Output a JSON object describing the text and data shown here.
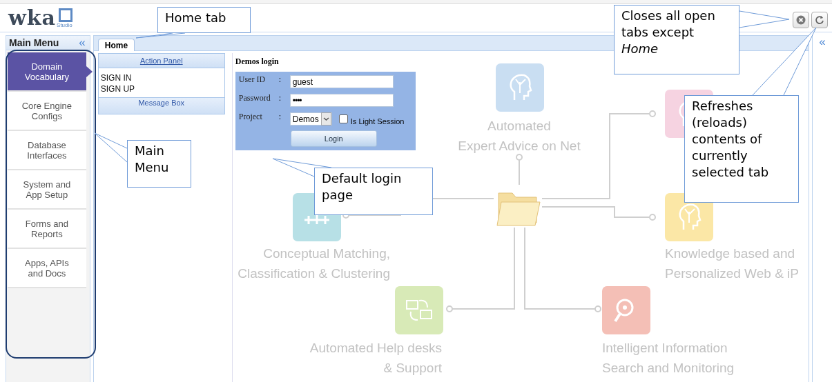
{
  "logo": {
    "text": "wka",
    "sub": "Studio"
  },
  "main_menu": {
    "title": "Main Menu",
    "collapse": "«",
    "items": [
      {
        "label": "Domain Vocabulary",
        "selected": true
      },
      {
        "label": "Core Engine Configs",
        "selected": false
      },
      {
        "label": "Database Interfaces",
        "selected": false
      },
      {
        "label": "System and App Setup",
        "selected": false
      },
      {
        "label": "Forms and Reports",
        "selected": false
      },
      {
        "label": "Apps, APIs and Docs",
        "selected": false
      }
    ]
  },
  "tabs": [
    {
      "label": "Home",
      "selected": true
    }
  ],
  "action_panel": {
    "title": "Action Panel",
    "links": [
      "SIGN IN",
      "SIGN UP"
    ],
    "message_box": "Message Box"
  },
  "login": {
    "title": "Demos login",
    "fields": [
      {
        "kind": "text",
        "label": "User ID",
        "separator": ":",
        "value": "guest"
      },
      {
        "kind": "password",
        "label": "Password",
        "separator": ":",
        "value": "••••"
      },
      {
        "kind": "select",
        "label": "Project",
        "separator": ":",
        "value": "Demos"
      }
    ],
    "light_session": {
      "label": "Is Light Session",
      "checked": false
    },
    "button": "Login"
  },
  "right_panel": {
    "collapse": "«"
  },
  "diagram": {
    "nodes": [
      {
        "kind": "head",
        "color": "#c9def2",
        "lines": [
          "Automated",
          "Expert Advice on Net"
        ]
      },
      {
        "kind": "tree",
        "color": "#f6d3e1"
      },
      {
        "kind": "network",
        "color": "#b7e0e6",
        "lines": [
          "Conceptual Matching,",
          "Classification & Clustering"
        ]
      },
      {
        "kind": "tree",
        "color": "#fbe7a6",
        "lines": [
          "Knowledge based and",
          "Personalized Web & iP"
        ]
      },
      {
        "kind": "help",
        "color": "#d8eab7",
        "lines": [
          "Automated Help desks",
          "& Support"
        ]
      },
      {
        "kind": "search",
        "color": "#f4bfb6",
        "lines": [
          "Intelligent Information",
          "Search and Monitoring"
        ]
      }
    ]
  },
  "callouts": [
    {
      "text": "Home tab"
    },
    {
      "text": "Main Menu"
    },
    {
      "text": "Closes all open tabs except *Home*"
    },
    {
      "text": "Default login page"
    },
    {
      "text": "Refreshes (reloads) contents of currently selected tab"
    }
  ]
}
